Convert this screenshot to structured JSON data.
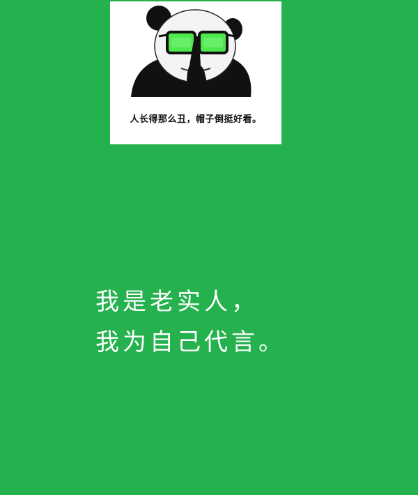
{
  "meme": {
    "caption": "人长得那么丑，帽子倒挺好看。",
    "icon": "panda-shush-glasses-icon",
    "accent_color": "#4ee84e"
  },
  "message": {
    "line1": "我是老实人，",
    "line2": "我为自己代言。"
  },
  "colors": {
    "background": "#25b14d",
    "text": "#ffffff"
  }
}
